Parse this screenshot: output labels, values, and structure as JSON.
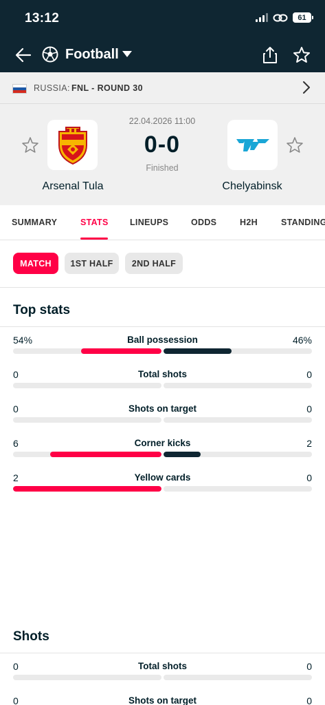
{
  "status_bar": {
    "time": "13:12",
    "battery": "61"
  },
  "nav": {
    "title": "Football"
  },
  "league": {
    "country": "RUSSIA:",
    "round": "FNL - ROUND 30"
  },
  "match": {
    "date": "22.04.2026 11:00",
    "score": "0-0",
    "status": "Finished",
    "home": {
      "name": "Arsenal Tula"
    },
    "away": {
      "name": "Chelyabinsk"
    }
  },
  "tabs": [
    {
      "label": "SUMMARY"
    },
    {
      "label": "STATS"
    },
    {
      "label": "LINEUPS"
    },
    {
      "label": "ODDS"
    },
    {
      "label": "H2H"
    },
    {
      "label": "STANDINGS"
    }
  ],
  "periods": [
    {
      "label": "MATCH"
    },
    {
      "label": "1ST HALF"
    },
    {
      "label": "2ND HALF"
    }
  ],
  "sections": {
    "top_stats": {
      "title": "Top stats",
      "rows": [
        {
          "label": "Ball possession",
          "home": "54%",
          "away": "46%",
          "home_share": 0.54,
          "away_share": 0.46
        },
        {
          "label": "Total shots",
          "home": "0",
          "away": "0",
          "home_share": 0,
          "away_share": 0
        },
        {
          "label": "Shots on target",
          "home": "0",
          "away": "0",
          "home_share": 0,
          "away_share": 0
        },
        {
          "label": "Corner kicks",
          "home": "6",
          "away": "2",
          "home_share": 0.75,
          "away_share": 0.25
        },
        {
          "label": "Yellow cards",
          "home": "2",
          "away": "0",
          "home_share": 1.0,
          "away_share": 0
        }
      ]
    },
    "shots": {
      "title": "Shots",
      "rows": [
        {
          "label": "Total shots",
          "home": "0",
          "away": "0",
          "home_share": 0,
          "away_share": 0
        },
        {
          "label": "Shots on target",
          "home": "0",
          "away": "0",
          "home_share": 0,
          "away_share": 0
        }
      ]
    }
  },
  "colors": {
    "accent": "#ff0046",
    "dark": "#0f2632",
    "track": "#eaeaea",
    "header_bg": "#f0f0f0"
  }
}
